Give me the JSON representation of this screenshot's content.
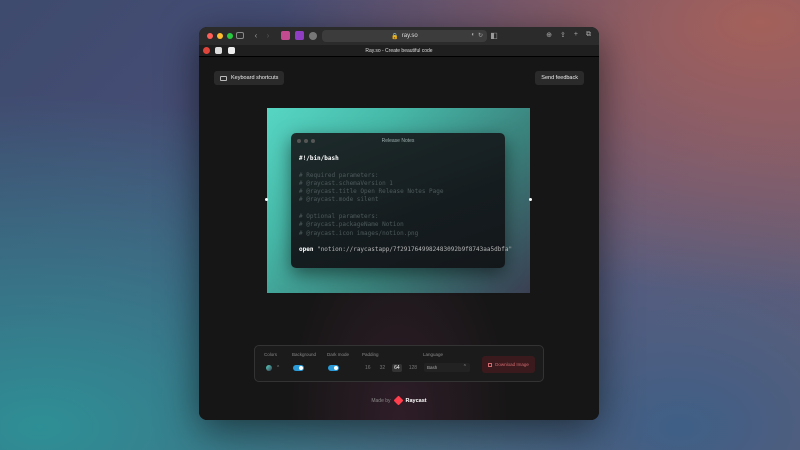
{
  "browser": {
    "url": "ray.so",
    "tab_title": "Ray.so - Create beautiful code",
    "lock_icon": "lock-icon"
  },
  "header": {
    "keyboard_shortcuts": "Keyboard shortcuts",
    "send_feedback": "Send feedback"
  },
  "code_window": {
    "title": "Release Notes",
    "lines": [
      {
        "text": "#!/bin/bash",
        "kind": "kw"
      },
      {
        "text": "",
        "kind": "plain"
      },
      {
        "text": "# Required parameters:",
        "kind": "cmt"
      },
      {
        "text": "# @raycast.schemaVersion 1",
        "kind": "cmt"
      },
      {
        "text": "# @raycast.title Open Release Notes Page",
        "kind": "cmt"
      },
      {
        "text": "# @raycast.mode silent",
        "kind": "cmt"
      },
      {
        "text": "",
        "kind": "plain"
      },
      {
        "text": "# Optional parameters:",
        "kind": "cmt"
      },
      {
        "text": "# @raycast.packageName Notion",
        "kind": "cmt"
      },
      {
        "text": "# @raycast.icon images/notion.png",
        "kind": "cmt"
      },
      {
        "text": "",
        "kind": "plain"
      }
    ],
    "last_line_kw": "open",
    "last_line_str": "\"notion://raycastapp/7f2917649982483092b9f8743aa5dbfa\""
  },
  "controls": {
    "colors_label": "Colors",
    "background_label": "Background",
    "dark_mode_label": "Dark mode",
    "padding_label": "Padding",
    "padding_options": [
      "16",
      "32",
      "64",
      "128"
    ],
    "padding_selected": "64",
    "language_label": "Language",
    "language_value": "Bash",
    "download_label": "Download Image",
    "background_on": true,
    "dark_mode_on": true
  },
  "footer": {
    "made_by": "Made by",
    "brand": "Raycast"
  },
  "colors": {
    "accent_toggle": "#2a9bd8",
    "download_text": "#d06a6f",
    "raycast_red": "#ff3e4d"
  }
}
